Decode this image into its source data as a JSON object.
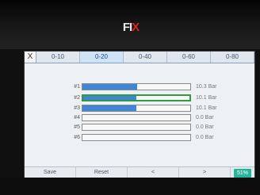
{
  "device": {
    "logo_main": "FI",
    "logo_accent": "X"
  },
  "tabs": {
    "close_label": "X",
    "items": [
      "0-10",
      "0-20",
      "0-40",
      "0-60",
      "0-80"
    ],
    "active_index": 1
  },
  "channels": [
    {
      "label": "#1",
      "value": "10.3 Bar",
      "fill_percent": 51
    },
    {
      "label": "#2",
      "value": "10.1 Bar",
      "fill_percent": 50
    },
    {
      "label": "#3",
      "value": "10.1 Bar",
      "fill_percent": 50
    },
    {
      "label": "#4",
      "value": "0.0 Bar",
      "fill_percent": 0
    },
    {
      "label": "#5",
      "value": "0.0 Bar",
      "fill_percent": 0
    },
    {
      "label": "#6",
      "value": "0.0 Bar",
      "fill_percent": 0
    }
  ],
  "selected_channel": 1,
  "footer": {
    "save": "Save",
    "reset": "Reset",
    "prev": "<",
    "next": ">",
    "battery": "51%"
  },
  "colors": {
    "bar": "#3f86d6",
    "selected_border": "#2f9a3f",
    "battery": "#27b59a"
  }
}
